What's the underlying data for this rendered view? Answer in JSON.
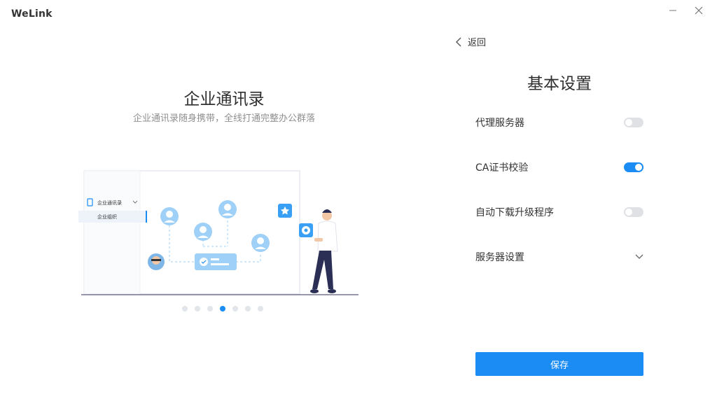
{
  "app": {
    "title": "WeLink"
  },
  "window_controls": {
    "minimize_icon": "minimize-icon",
    "close_icon": "close-icon"
  },
  "slide": {
    "title": "企业通讯录",
    "subtitle": "企业通讯录随身携带，全线打通完整办公群落",
    "illustration": {
      "menu_item": "企业通讯录",
      "sub_item": "企业组织"
    },
    "pagination": {
      "count": 7,
      "active_index": 3
    }
  },
  "settings": {
    "back_label": "返回",
    "title": "基本设置",
    "items": [
      {
        "label": "代理服务器",
        "control": "toggle",
        "on": false
      },
      {
        "label": "CA证书校验",
        "control": "toggle",
        "on": true
      },
      {
        "label": "自动下载升级程序",
        "control": "toggle",
        "on": false
      },
      {
        "label": "服务器设置",
        "control": "expand"
      }
    ],
    "save_label": "保存"
  },
  "colors": {
    "accent": "#1a8cf4",
    "toggle_off": "#dfe1e5",
    "avatar": "#9fd0f8"
  }
}
